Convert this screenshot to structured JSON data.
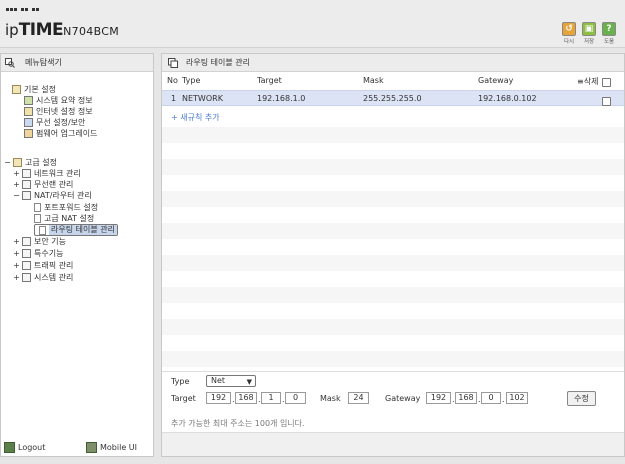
{
  "header": {
    "logo_ip": "ip",
    "logo_time": "TIME",
    "logo_model": "N704BCM",
    "buttons": [
      {
        "label": "다시",
        "icon": "restart-icon"
      },
      {
        "label": "저장",
        "icon": "save-icon"
      },
      {
        "label": "도움",
        "icon": "help-icon",
        "glyph": "?"
      }
    ]
  },
  "sidebar": {
    "title": "메뉴탐색기",
    "basic": {
      "label": "기본 설정",
      "items": [
        "시스템 요약 정보",
        "인터넷 설정 정보",
        "무선 설정/보안",
        "펌웨어 업그레이드"
      ]
    },
    "advanced": {
      "label": "고급 설정",
      "items": [
        {
          "label": "네트워크 관리",
          "exp": "+"
        },
        {
          "label": "무선랜 관리",
          "exp": "+"
        },
        {
          "label": "NAT/라우터 관리",
          "exp": "−"
        },
        {
          "label": "포트포워드 설정",
          "child": true
        },
        {
          "label": "고급 NAT 설정",
          "child": true
        },
        {
          "label": "라우팅 테이블 관리",
          "child": true,
          "selected": true
        },
        {
          "label": "보안 기능",
          "exp": "+"
        },
        {
          "label": "특수기능",
          "exp": "+"
        },
        {
          "label": "트래픽 관리",
          "exp": "+"
        },
        {
          "label": "시스템 관리",
          "exp": "+"
        }
      ]
    },
    "footer": {
      "logout": "Logout",
      "mobile": "Mobile UI"
    }
  },
  "main": {
    "title": "라우팅 테이블 관리",
    "columns": {
      "no": "No",
      "type": "Type",
      "target": "Target",
      "mask": "Mask",
      "gateway": "Gateway",
      "delete": "삭제"
    },
    "rows": [
      {
        "no": "1",
        "type": "NETWORK",
        "target": "192.168.1.0",
        "mask": "255.255.255.0",
        "gateway": "192.168.0.102"
      }
    ],
    "add_new": "+ 새규칙 추가",
    "form": {
      "type_label": "Type",
      "type_value": "Net",
      "target_label": "Target",
      "target": [
        "192",
        "168",
        "1",
        "0"
      ],
      "mask_label": "Mask",
      "mask": "24",
      "gateway_label": "Gateway",
      "gateway": [
        "192",
        "168",
        "0",
        "102"
      ],
      "edit_button": "수정"
    },
    "note": "추가 가능한 최대 주소는 100개 입니다."
  }
}
